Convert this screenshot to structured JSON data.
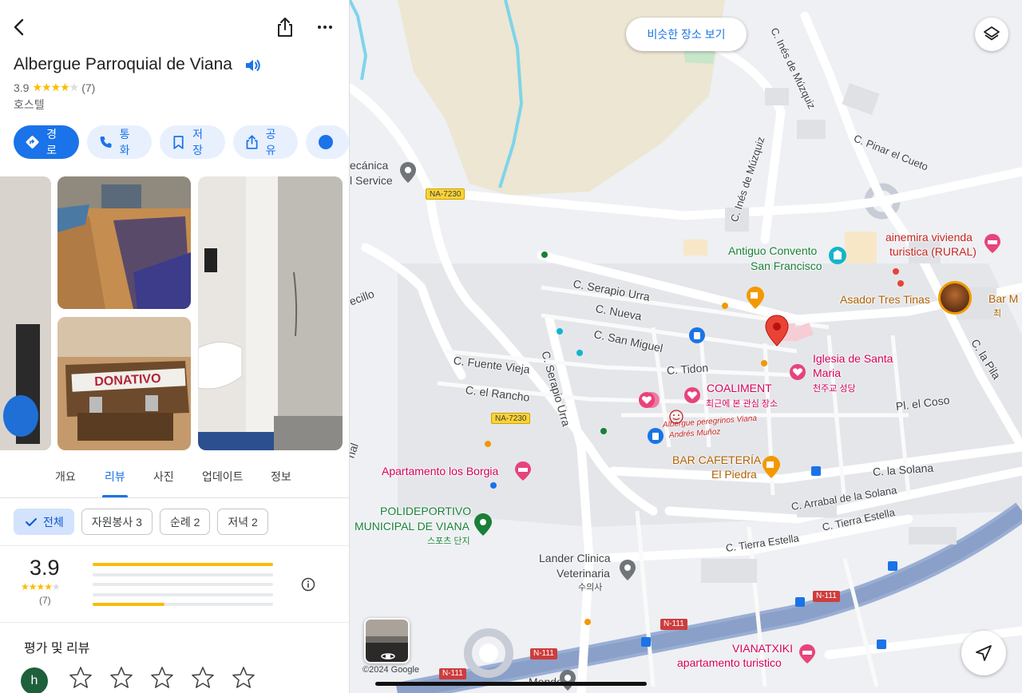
{
  "place": {
    "title": "Albergue Parroquial de Viana",
    "rating": "3.9",
    "review_count": "(7)",
    "stars_filled": 4,
    "category": "호스텔"
  },
  "actions": {
    "directions": "경로",
    "call": "통화",
    "save": "저장",
    "share": "공유"
  },
  "tabs": [
    "개요",
    "리뷰",
    "사진",
    "업데이트",
    "정보"
  ],
  "active_tab": "리뷰",
  "photos": {
    "donation_sign": "DONATIVO"
  },
  "filters": [
    {
      "label": "전체",
      "active": true
    },
    {
      "label": "자원봉사 3",
      "active": false
    },
    {
      "label": "순례 2",
      "active": false
    },
    {
      "label": "저녁 2",
      "active": false
    }
  ],
  "summary": {
    "score": "3.9",
    "count": "(7)",
    "distribution": [
      {
        "stars": 5,
        "fraction": 1.0
      },
      {
        "stars": 4,
        "fraction": 0.0
      },
      {
        "stars": 3,
        "fraction": 0.0
      },
      {
        "stars": 2,
        "fraction": 0.0
      },
      {
        "stars": 1,
        "fraction": 0.4
      }
    ]
  },
  "reviews_section": {
    "title": "평가 및 리뷰",
    "user_initial": "h"
  },
  "map": {
    "similar_places": "비슷한 장소 보기",
    "copyright": "©2024 Google",
    "streets": {
      "ines_top": "C. Inés de Múzquiz",
      "ines_mid": "C. Inés de Múzquiz",
      "pinar": "C. Pinar el Cueto",
      "serapio_urra_h": "C. Serapio Urra",
      "serapio_urra_v": "C. Serapio Urra",
      "nueva": "C. Nueva",
      "san_miguel": "C. San Miguel",
      "fuente_vieja": "C. Fuente Vieja",
      "el_rancho": "C. el Rancho",
      "tidon": "C. Tidon",
      "la_pila": "C. la Pila",
      "pl_el_coso": "Pl. el Coso",
      "la_solana": "C. la Solana",
      "arrabal": "C. Arrabal de la Solana",
      "tierra_estella_1": "C. Tierra Estella",
      "tierra_estella_2": "C. Tierra Estella",
      "cecillo": "ecillo",
      "mendoza": "Mendoza",
      "nal": "nal"
    },
    "shields": {
      "na7230_top": "NA-7230",
      "na7230_mid": "NA-7230",
      "n111_a": "N-111",
      "n111_b": "N-111",
      "n111_c": "N-111",
      "n111_d": "N-111"
    },
    "pois": {
      "mecanica_1": "ecánica",
      "mecanica_2": "l Service",
      "convento_1": "Antiguo Convento",
      "convento_2": "San Francisco",
      "vivienda_1": "ainemira vivienda",
      "vivienda_2": "turistica (RURAL)",
      "asador": "Asador Tres Tinas",
      "bar_m": "Bar M",
      "bar_m_sub": "최",
      "iglesia_1": "Iglesia de Santa",
      "iglesia_2": "Maria",
      "iglesia_sub": "천주교 성당",
      "coaliment": "COALIMENT",
      "coaliment_sub": "최근에 본 관심 장소",
      "albergue_handwritten_1": "Albergue peregrinos Viana",
      "albergue_handwritten_2": "Andrés Muñoz",
      "bar_cafeteria_1": "BAR CAFETERÍA",
      "bar_cafeteria_2": "El Piedra",
      "borgia": "Apartamento los Borgia",
      "polideportivo_1": "POLIDEPORTIVO",
      "polideportivo_2": "MUNICIPAL DE VIANA",
      "polideportivo_sub": "스포츠 단지",
      "lander_1": "Lander Clinica",
      "lander_2": "Veterinaria",
      "lander_sub": "수의사",
      "vianatxiki_1": "VIANATXIKI",
      "vianatxiki_2": "apartamento turistico"
    }
  },
  "colors": {
    "accent": "#1a73e8",
    "star": "#fbbc04",
    "pin_red": "#ea4335",
    "park_green": "#188038",
    "lodging_pink": "#e8437a",
    "food_orange": "#f29900",
    "highway": "#8aa0c8"
  }
}
